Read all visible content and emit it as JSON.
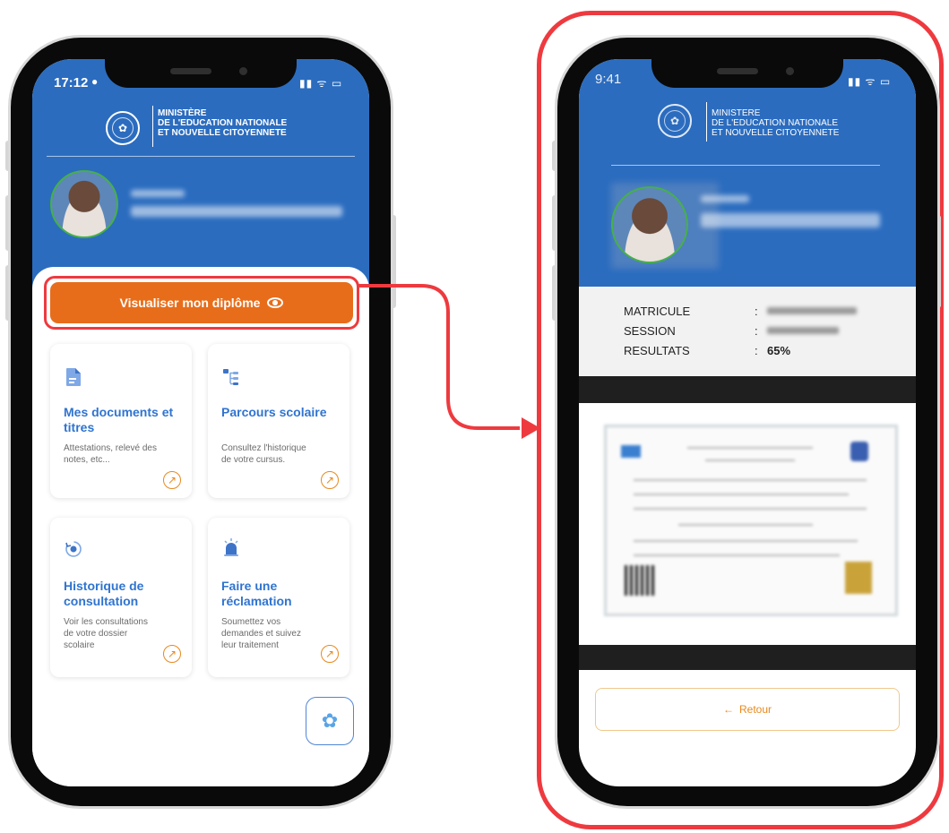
{
  "left_phone": {
    "status_time": "17:12",
    "ministry_lines": [
      "MINISTÈRE",
      "DE L'EDUCATION NATIONALE",
      "ET NOUVELLE CITOYENNETE"
    ],
    "view_diploma_button": "Visualiser mon diplôme",
    "cards": [
      {
        "title": "Mes documents et titres",
        "description": "Attestations, relevé des notes, etc..."
      },
      {
        "title": "Parcours scolaire",
        "description": "Consultez l'historique de votre cursus."
      },
      {
        "title": "Historique de consultation",
        "description": "Voir les consultations de votre dossier scolaire"
      },
      {
        "title": "Faire une réclamation",
        "description": "Soumettez vos demandes et suivez leur traitement"
      }
    ]
  },
  "right_phone": {
    "status_time": "9:41",
    "ministry_lines": [
      "MINISTERE",
      "DE L'EDUCATION NATIONALE",
      "ET NOUVELLE CITOYENNETE"
    ],
    "info": {
      "matricule_label": "MATRICULE",
      "session_label": "SESSION",
      "resultats_label": "RESULTATS",
      "colon": ":",
      "resultats_value": "65%"
    },
    "retour_button": "Retour"
  },
  "colors": {
    "header_blue": "#2b6cbf",
    "button_orange": "#e86d1a",
    "highlight_red": "#ee3a3f",
    "card_title_blue": "#2f74d0",
    "avatar_ring_green": "#46b04a"
  },
  "icons": [
    "document-icon",
    "tree-icon",
    "history-icon",
    "alarm-icon",
    "arrow-up-right-icon",
    "eye-icon",
    "flower-icon",
    "arrow-left-icon"
  ]
}
